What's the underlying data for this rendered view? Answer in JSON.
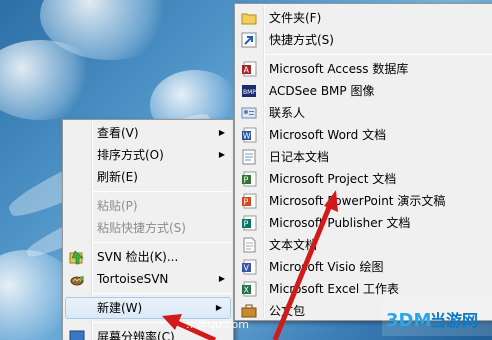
{
  "context_menu": {
    "items": [
      {
        "label": "查看(V)",
        "submenu": true,
        "disabled": false
      },
      {
        "label": "排序方式(O)",
        "submenu": true,
        "disabled": false
      },
      {
        "label": "刷新(E)",
        "submenu": false,
        "disabled": false
      },
      {
        "label": "粘贴(P)",
        "submenu": false,
        "disabled": true
      },
      {
        "label": "粘贴快捷方式(S)",
        "submenu": false,
        "disabled": true
      },
      {
        "label": "SVN 检出(K)...",
        "submenu": false,
        "disabled": false,
        "icon": "svn-checkout-icon"
      },
      {
        "label": "TortoiseSVN",
        "submenu": true,
        "disabled": false,
        "icon": "tortoisesvn-icon"
      },
      {
        "label": "新建(W)",
        "submenu": true,
        "disabled": false
      },
      {
        "label": "屏幕分辨率(C)",
        "submenu": false,
        "disabled": false
      }
    ]
  },
  "new_submenu": {
    "items": [
      {
        "label": "文件夹(F)",
        "icon": "folder-icon"
      },
      {
        "label": "快捷方式(S)",
        "icon": "shortcut-icon"
      },
      {
        "label": "Microsoft Access 数据库",
        "icon": "access-icon"
      },
      {
        "label": "ACDSee BMP 图像",
        "icon": "bmp-icon"
      },
      {
        "label": "联系人",
        "icon": "contact-icon"
      },
      {
        "label": "Microsoft Word 文档",
        "icon": "word-icon"
      },
      {
        "label": "日记本文档",
        "icon": "journal-icon"
      },
      {
        "label": "Microsoft Project 文档",
        "icon": "project-icon"
      },
      {
        "label": "Microsoft PowerPoint 演示文稿",
        "icon": "powerpoint-icon"
      },
      {
        "label": "Microsoft Publisher 文档",
        "icon": "publisher-icon"
      },
      {
        "label": "文本文档",
        "icon": "text-icon"
      },
      {
        "label": "Microsoft Visio 绘图",
        "icon": "visio-icon"
      },
      {
        "label": "Microsoft Excel 工作表",
        "icon": "excel-icon"
      },
      {
        "label": "公文包",
        "icon": "briefcase-icon"
      }
    ]
  },
  "overlay": {
    "email": "…@qq.com",
    "watermark_text": "当游网",
    "watermark_sub": "3DM"
  },
  "colors": {
    "menu_bg": "#f0f0f0",
    "arrow_red": "#d11a1a",
    "desktop_blue": "#4e93c6"
  }
}
